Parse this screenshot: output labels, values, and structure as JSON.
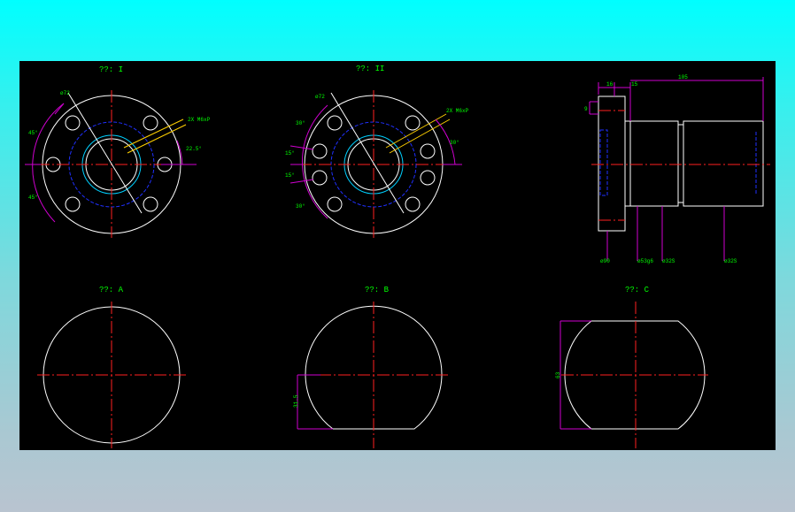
{
  "views": {
    "view1": {
      "title": "??: I",
      "dia": "ø72",
      "callout": "2X M6xP",
      "angle_a": "45°",
      "angle_b": "45°",
      "angle_c": "22.5°"
    },
    "view2": {
      "title": "??: II",
      "dia": "ø72",
      "callout": "2X M6xP",
      "angle_a": "30°",
      "angle_b": "15°",
      "angle_c": "15°",
      "angle_d": "30°",
      "angle_e": "30°"
    },
    "view3": {
      "overall": "105",
      "seg1": "16",
      "seg2": "15",
      "thick": "9",
      "d1": "ø90",
      "d2": "ø53g6",
      "d3": "ø32S",
      "d4": "ø32S"
    },
    "viewA": {
      "title": "??: A"
    },
    "viewB": {
      "title": "??: B",
      "dim": "31.5"
    },
    "viewC": {
      "title": "??: C",
      "dim": "63"
    }
  },
  "colors": {
    "background": "#000000",
    "outline": "#ffffff",
    "centerline": "#ff2020",
    "dimension": "#d000d0",
    "text": "#00ff00"
  }
}
